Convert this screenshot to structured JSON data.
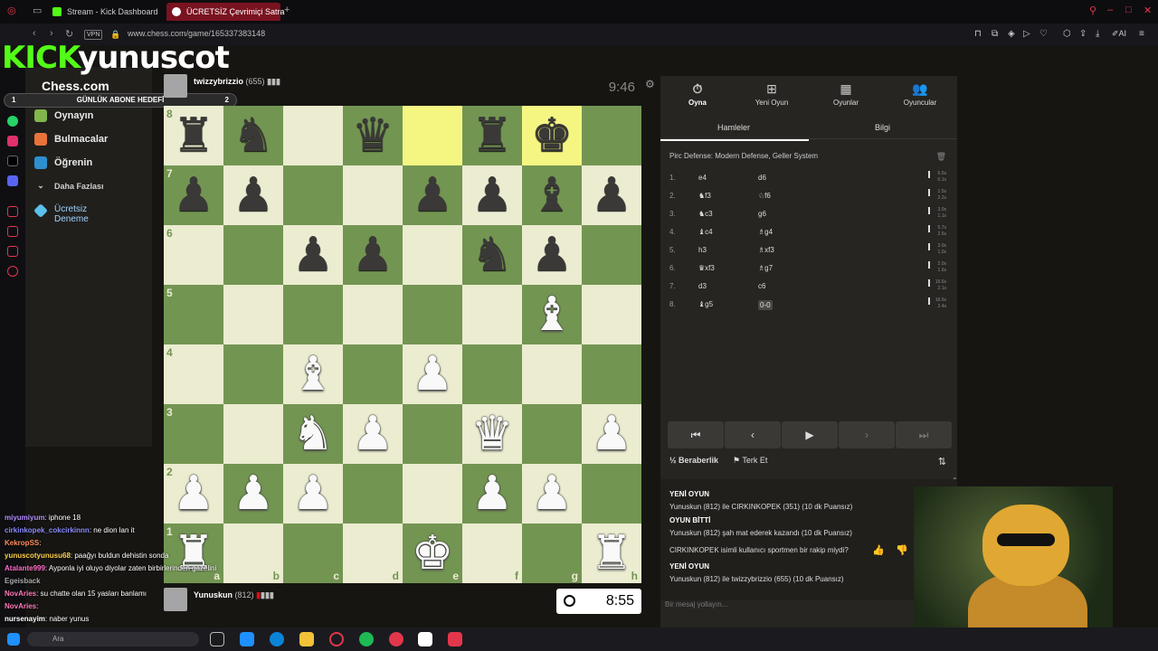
{
  "browser": {
    "tabs": [
      {
        "label": "Stream - Kick Dashboard"
      },
      {
        "label": "ÜCRETSİZ Çevrimiçi Satra"
      }
    ],
    "vpn_label": "VPN",
    "url": "www.chess.com/game/165337383148",
    "ai_label": "AI"
  },
  "overlay": {
    "kick_text": "KICK",
    "channel": "yunuscot",
    "goal_label": "GÜNLÜK ABONE HEDEFİ",
    "goal_current": "1",
    "goal_target": "2"
  },
  "sidebar": {
    "logo": "Chess.com",
    "items": [
      {
        "label": "Oynayın",
        "icon": "pawn-icon"
      },
      {
        "label": "Bulmacalar",
        "icon": "puzzle-icon"
      },
      {
        "label": "Öğrenin",
        "icon": "learn-icon"
      },
      {
        "label": "Daha Fazlası",
        "icon": "chevron-down-icon"
      },
      {
        "label": "Ücretsiz Deneme",
        "icon": "diamond-icon"
      }
    ]
  },
  "opponent": {
    "name": "twizzybrizzio",
    "rating": "(655)",
    "clock": "9:46"
  },
  "player": {
    "name": "Yunuskun",
    "rating": "(812)",
    "clock": "8:55"
  },
  "board": {
    "orientation": "white",
    "ranks": [
      "8",
      "7",
      "6",
      "5",
      "4",
      "3",
      "2",
      "1"
    ],
    "files": [
      "a",
      "b",
      "c",
      "d",
      "e",
      "f",
      "g",
      "h"
    ],
    "rows": [
      [
        "r",
        "n",
        "",
        "q",
        "",
        "r",
        "k",
        ""
      ],
      [
        "p",
        "p",
        "",
        "",
        "p",
        "p",
        "b",
        "p"
      ],
      [
        "",
        "",
        "p",
        "p",
        "",
        "n",
        "p",
        ""
      ],
      [
        "",
        "",
        "",
        "",
        "",
        "",
        "B",
        ""
      ],
      [
        "",
        "",
        "B",
        "",
        "P",
        "",
        "",
        ""
      ],
      [
        "",
        "",
        "N",
        "P",
        "",
        "Q",
        "",
        "P"
      ],
      [
        "P",
        "P",
        "P",
        "",
        "",
        "P",
        "P",
        ""
      ],
      [
        "R",
        "",
        "",
        "",
        "K",
        "",
        "",
        "R"
      ]
    ],
    "highlight": [
      "e8",
      "g8"
    ]
  },
  "panel": {
    "tabs": [
      {
        "label": "Oyna",
        "icon": "clock-icon"
      },
      {
        "label": "Yeni Oyun",
        "icon": "plus-icon"
      },
      {
        "label": "Oyunlar",
        "icon": "board-icon"
      },
      {
        "label": "Oyuncular",
        "icon": "players-icon"
      }
    ],
    "subtabs": [
      "Hamleler",
      "Bilgi"
    ],
    "opening": "Pirc Defense: Modern Defense, Geller System",
    "moves": [
      {
        "no": "1.",
        "w": "e4",
        "b": "d6",
        "t1": "6.6s",
        "t2": "0.1s"
      },
      {
        "no": "2.",
        "w": "♞f3",
        "b": "♘f6",
        "t1": "1.5s",
        "t2": "2.2s"
      },
      {
        "no": "3.",
        "w": "♞c3",
        "b": "g6",
        "t1": "3.0s",
        "t2": "1.1s"
      },
      {
        "no": "4.",
        "w": "♝c4",
        "b": "♗g4",
        "t1": "5.7s",
        "t2": "2.6s"
      },
      {
        "no": "5.",
        "w": "h3",
        "b": "♗xf3",
        "t1": "3.0s",
        "t2": "1.0s"
      },
      {
        "no": "6.",
        "w": "♛xf3",
        "b": "♗g7",
        "t1": "2.0s",
        "t2": "1.6s"
      },
      {
        "no": "7.",
        "w": "d3",
        "b": "c6",
        "t1": "19.6s",
        "t2": "2.1s"
      },
      {
        "no": "8.",
        "w": "♝g5",
        "b": "0-0",
        "t1": "16.6s",
        "t2": "2.4s"
      }
    ],
    "draw_label": "Beraberlik",
    "resign_label": "Terk Et",
    "chat": [
      {
        "kind": "hd",
        "text": "YENİ OYUN"
      },
      {
        "kind": "tx",
        "text": "Yunuskun (812) ile CIRKINKOPEK (351) (10 dk Puansız)"
      },
      {
        "kind": "hd",
        "text": "OYUN BİTTİ"
      },
      {
        "kind": "tx",
        "text": "Yunuskun (812) şah mat ederek kazandı (10 dk Puansız)"
      },
      {
        "kind": "tx",
        "text": "CIRKINKOPEK isimli kullanıcı sportmen bir rakip miydi?"
      },
      {
        "kind": "hd",
        "text": "YENİ OYUN"
      },
      {
        "kind": "tx",
        "text": "Yunuskun (812) ile twizzybrizzio (655) (10 dk Puansız)"
      }
    ],
    "chat_placeholder": "Bir mesaj yollayın..."
  },
  "stream_chat": [
    {
      "user": "miyumiyum",
      "msg": ": iphone 18",
      "color": "#b48cff"
    },
    {
      "user": "cirkinkopek_cokcirkinnn",
      "msg": ": ne dion lan it",
      "color": "#8c8cff"
    },
    {
      "user": "KekropSS",
      "msg": ":",
      "color": "#ff8c5a"
    },
    {
      "user": "yunuscotyunusu68",
      "msg": ": paağyı buldun dehistin sonda",
      "color": "#ffd34d"
    },
    {
      "user": "Atalante999",
      "msg": ": Ayponla iyi oluyo diyolar zaten birbirlerinden gazelini",
      "color": "#ff6ec7"
    },
    {
      "user": "Egeisback",
      "msg": "",
      "color": "#aaa"
    },
    {
      "user": "NovAries",
      "msg": ": su chatte olan 15 yasları banlamı",
      "color": "#ff7ab8"
    },
    {
      "user": "NovAries",
      "msg": ":",
      "color": "#ff7ab8"
    },
    {
      "user": "nursenayim",
      "msg": ": naber yunus",
      "color": "#fff"
    }
  ],
  "taskbar": {
    "search_placeholder": "Ara"
  }
}
